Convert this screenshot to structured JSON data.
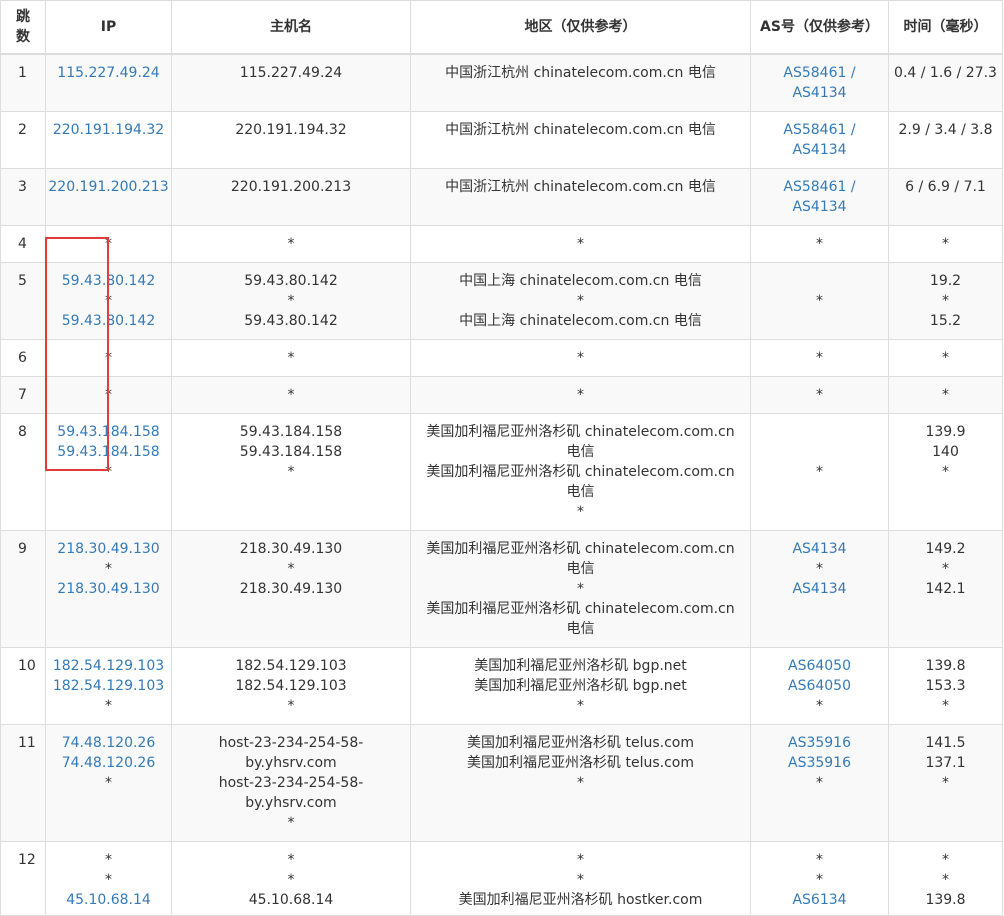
{
  "headers": {
    "hop": "跳数",
    "ip": "IP",
    "host": "主机名",
    "region": "地区（仅供参考）",
    "as": "AS号（仅供参考）",
    "time": "时间（毫秒）"
  },
  "highlight_color": "#e03c3c",
  "link_color": "#337ab7",
  "rows": [
    {
      "hop": "1",
      "ip": [
        "115.227.49.24"
      ],
      "host": [
        "115.227.49.24"
      ],
      "region": [
        "中国浙江杭州 chinatelecom.com.cn 电信"
      ],
      "as": [
        "AS58461 / AS4134"
      ],
      "time": [
        "0.4 / 1.6 / 27.3"
      ]
    },
    {
      "hop": "2",
      "ip": [
        "220.191.194.32"
      ],
      "host": [
        "220.191.194.32"
      ],
      "region": [
        "中国浙江杭州 chinatelecom.com.cn 电信"
      ],
      "as": [
        "AS58461 / AS4134"
      ],
      "time": [
        "2.9 / 3.4 / 3.8"
      ]
    },
    {
      "hop": "3",
      "ip": [
        "220.191.200.213"
      ],
      "host": [
        "220.191.200.213"
      ],
      "region": [
        "中国浙江杭州 chinatelecom.com.cn 电信"
      ],
      "as": [
        "AS58461 / AS4134"
      ],
      "time": [
        "6 / 6.9 / 7.1"
      ]
    },
    {
      "hop": "4",
      "ip": [
        "*"
      ],
      "host": [
        "*"
      ],
      "region": [
        "*"
      ],
      "as": [
        "*"
      ],
      "time": [
        "*"
      ]
    },
    {
      "hop": "5",
      "ip": [
        "59.43.80.142",
        "*",
        "59.43.80.142"
      ],
      "host": [
        "59.43.80.142",
        "*",
        "59.43.80.142"
      ],
      "region": [
        "中国上海 chinatelecom.com.cn 电信",
        "*",
        "中国上海 chinatelecom.com.cn 电信"
      ],
      "as": [
        "",
        "*",
        ""
      ],
      "time": [
        "19.2",
        "*",
        "15.2"
      ]
    },
    {
      "hop": "6",
      "ip": [
        "*"
      ],
      "host": [
        "*"
      ],
      "region": [
        "*"
      ],
      "as": [
        "*"
      ],
      "time": [
        "*"
      ]
    },
    {
      "hop": "7",
      "ip": [
        "*"
      ],
      "host": [
        "*"
      ],
      "region": [
        "*"
      ],
      "as": [
        "*"
      ],
      "time": [
        "*"
      ]
    },
    {
      "hop": "8",
      "ip": [
        "59.43.184.158",
        "59.43.184.158",
        "*"
      ],
      "host": [
        "59.43.184.158",
        "59.43.184.158",
        "*"
      ],
      "region": [
        "美国加利福尼亚州洛杉矶 chinatelecom.com.cn 电信",
        "美国加利福尼亚州洛杉矶 chinatelecom.com.cn 电信",
        "*"
      ],
      "as": [
        "",
        "",
        "*"
      ],
      "time": [
        "139.9",
        "140",
        "*"
      ]
    },
    {
      "hop": "9",
      "ip": [
        "218.30.49.130",
        "*",
        "218.30.49.130"
      ],
      "host": [
        "218.30.49.130",
        "*",
        "218.30.49.130"
      ],
      "region": [
        "美国加利福尼亚州洛杉矶 chinatelecom.com.cn 电信",
        "*",
        "美国加利福尼亚州洛杉矶 chinatelecom.com.cn 电信"
      ],
      "as": [
        "AS4134",
        "*",
        "AS4134"
      ],
      "time": [
        "149.2",
        "*",
        "142.1"
      ]
    },
    {
      "hop": "10",
      "ip": [
        "182.54.129.103",
        "182.54.129.103",
        "*"
      ],
      "host": [
        "182.54.129.103",
        "182.54.129.103",
        "*"
      ],
      "region": [
        "美国加利福尼亚州洛杉矶 bgp.net",
        "美国加利福尼亚州洛杉矶 bgp.net",
        "*"
      ],
      "as": [
        "AS64050",
        "AS64050",
        "*"
      ],
      "time": [
        "139.8",
        "153.3",
        "*"
      ]
    },
    {
      "hop": "11",
      "ip": [
        "74.48.120.26",
        "74.48.120.26",
        "*"
      ],
      "host": [
        "host-23-234-254-58-by.yhsrv.com",
        "host-23-234-254-58-by.yhsrv.com",
        "*"
      ],
      "region": [
        "美国加利福尼亚州洛杉矶 telus.com",
        "美国加利福尼亚州洛杉矶 telus.com",
        "*"
      ],
      "as": [
        "AS35916",
        "AS35916",
        "*"
      ],
      "time": [
        "141.5",
        "137.1",
        "*"
      ]
    },
    {
      "hop": "12",
      "ip": [
        "*",
        "*",
        "45.10.68.14"
      ],
      "host": [
        "*",
        "*",
        "45.10.68.14"
      ],
      "region": [
        "*",
        "*",
        "美国加利福尼亚州洛杉矶 hostker.com"
      ],
      "as": [
        "*",
        "*",
        "AS6134"
      ],
      "time": [
        "*",
        "*",
        "139.8"
      ]
    }
  ]
}
